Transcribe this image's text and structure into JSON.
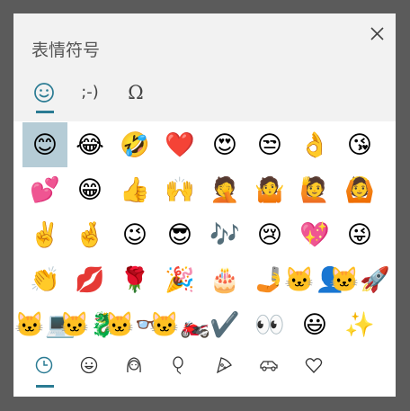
{
  "window": {
    "title": "表情符号"
  },
  "tabs": [
    {
      "name": "emoji",
      "label": "☺"
    },
    {
      "name": "kaomoji",
      "label": ";-)"
    },
    {
      "name": "symbols",
      "label": "Ω"
    }
  ],
  "emoji_grid": [
    [
      "😊",
      "😂",
      "🤣",
      "❤️",
      "😍",
      "😒",
      "👌",
      "😘"
    ],
    [
      "💕",
      "😁",
      "👍",
      "🙌",
      "🤦",
      "🤷",
      "🙋",
      "🙆"
    ],
    [
      "✌️",
      "🤞",
      "😉",
      "😎",
      "🎶",
      "😢",
      "💖",
      "😜"
    ],
    [
      "👏",
      "💋",
      "🌹",
      "🎉",
      "🎂",
      "🤳",
      "🐱‍👤",
      "🐱‍🚀"
    ],
    [
      "🐱‍💻",
      "🐱‍🐉",
      "🐱‍👓",
      "🐱‍🏍",
      "✔️",
      "👀",
      "😃",
      "✨"
    ]
  ],
  "categories": [
    {
      "name": "recent",
      "icon": "clock-icon"
    },
    {
      "name": "smileys",
      "icon": "smiley-icon"
    },
    {
      "name": "people",
      "icon": "person-icon"
    },
    {
      "name": "celebration",
      "icon": "balloon-icon"
    },
    {
      "name": "food",
      "icon": "pizza-icon"
    },
    {
      "name": "travel",
      "icon": "car-icon"
    },
    {
      "name": "symbols",
      "icon": "heart-icon"
    }
  ],
  "colors": {
    "accent": "#2a7b93",
    "selected_bg": "#b5ccd6",
    "header_bg": "#f2f2f2"
  }
}
